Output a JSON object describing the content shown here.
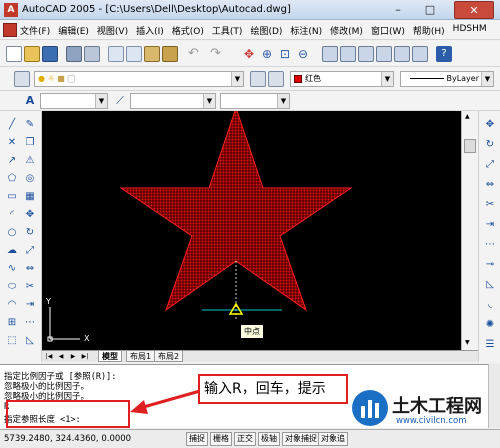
{
  "window": {
    "title": "AutoCAD 2005 - [C:\\Users\\Dell\\Desktop\\Autocad.dwg]",
    "minimize": "–",
    "maximize": "□",
    "close": "✕"
  },
  "menu": {
    "items": [
      "文件(F)",
      "编辑(E)",
      "视图(V)",
      "插入(I)",
      "格式(O)",
      "工具(T)",
      "绘图(D)",
      "标注(N)",
      "修改(M)",
      "窗口(W)",
      "帮助(H)",
      "HDSHM"
    ]
  },
  "properties": {
    "color_value": "红色",
    "linetype_value": "ByLayer"
  },
  "drawing": {
    "osnap_tooltip": "中点",
    "ucs_x": "X",
    "ucs_y": "Y",
    "star_color": "#e01010"
  },
  "layout_tabs": [
    "模型",
    "布局1",
    "布局2"
  ],
  "command": {
    "lines": [
      "指定比例因子或 [参照(R)]:",
      "忽略极小的比例因子。",
      "忽略极小的比例因子。",
      "R",
      "指定参照长度 <1>:"
    ]
  },
  "status": {
    "coords": "5739.2480, 324.4360, 0.0000",
    "toggles": [
      "捕捉",
      "栅格",
      "正交",
      "极轴",
      "对象捕捉",
      "对象追"
    ]
  },
  "annotation": {
    "callout_text": "输入R，回车，提示",
    "accent_color": "#e02020"
  },
  "watermark": {
    "title": "土木工程网",
    "url": "www.civilcn.com"
  }
}
